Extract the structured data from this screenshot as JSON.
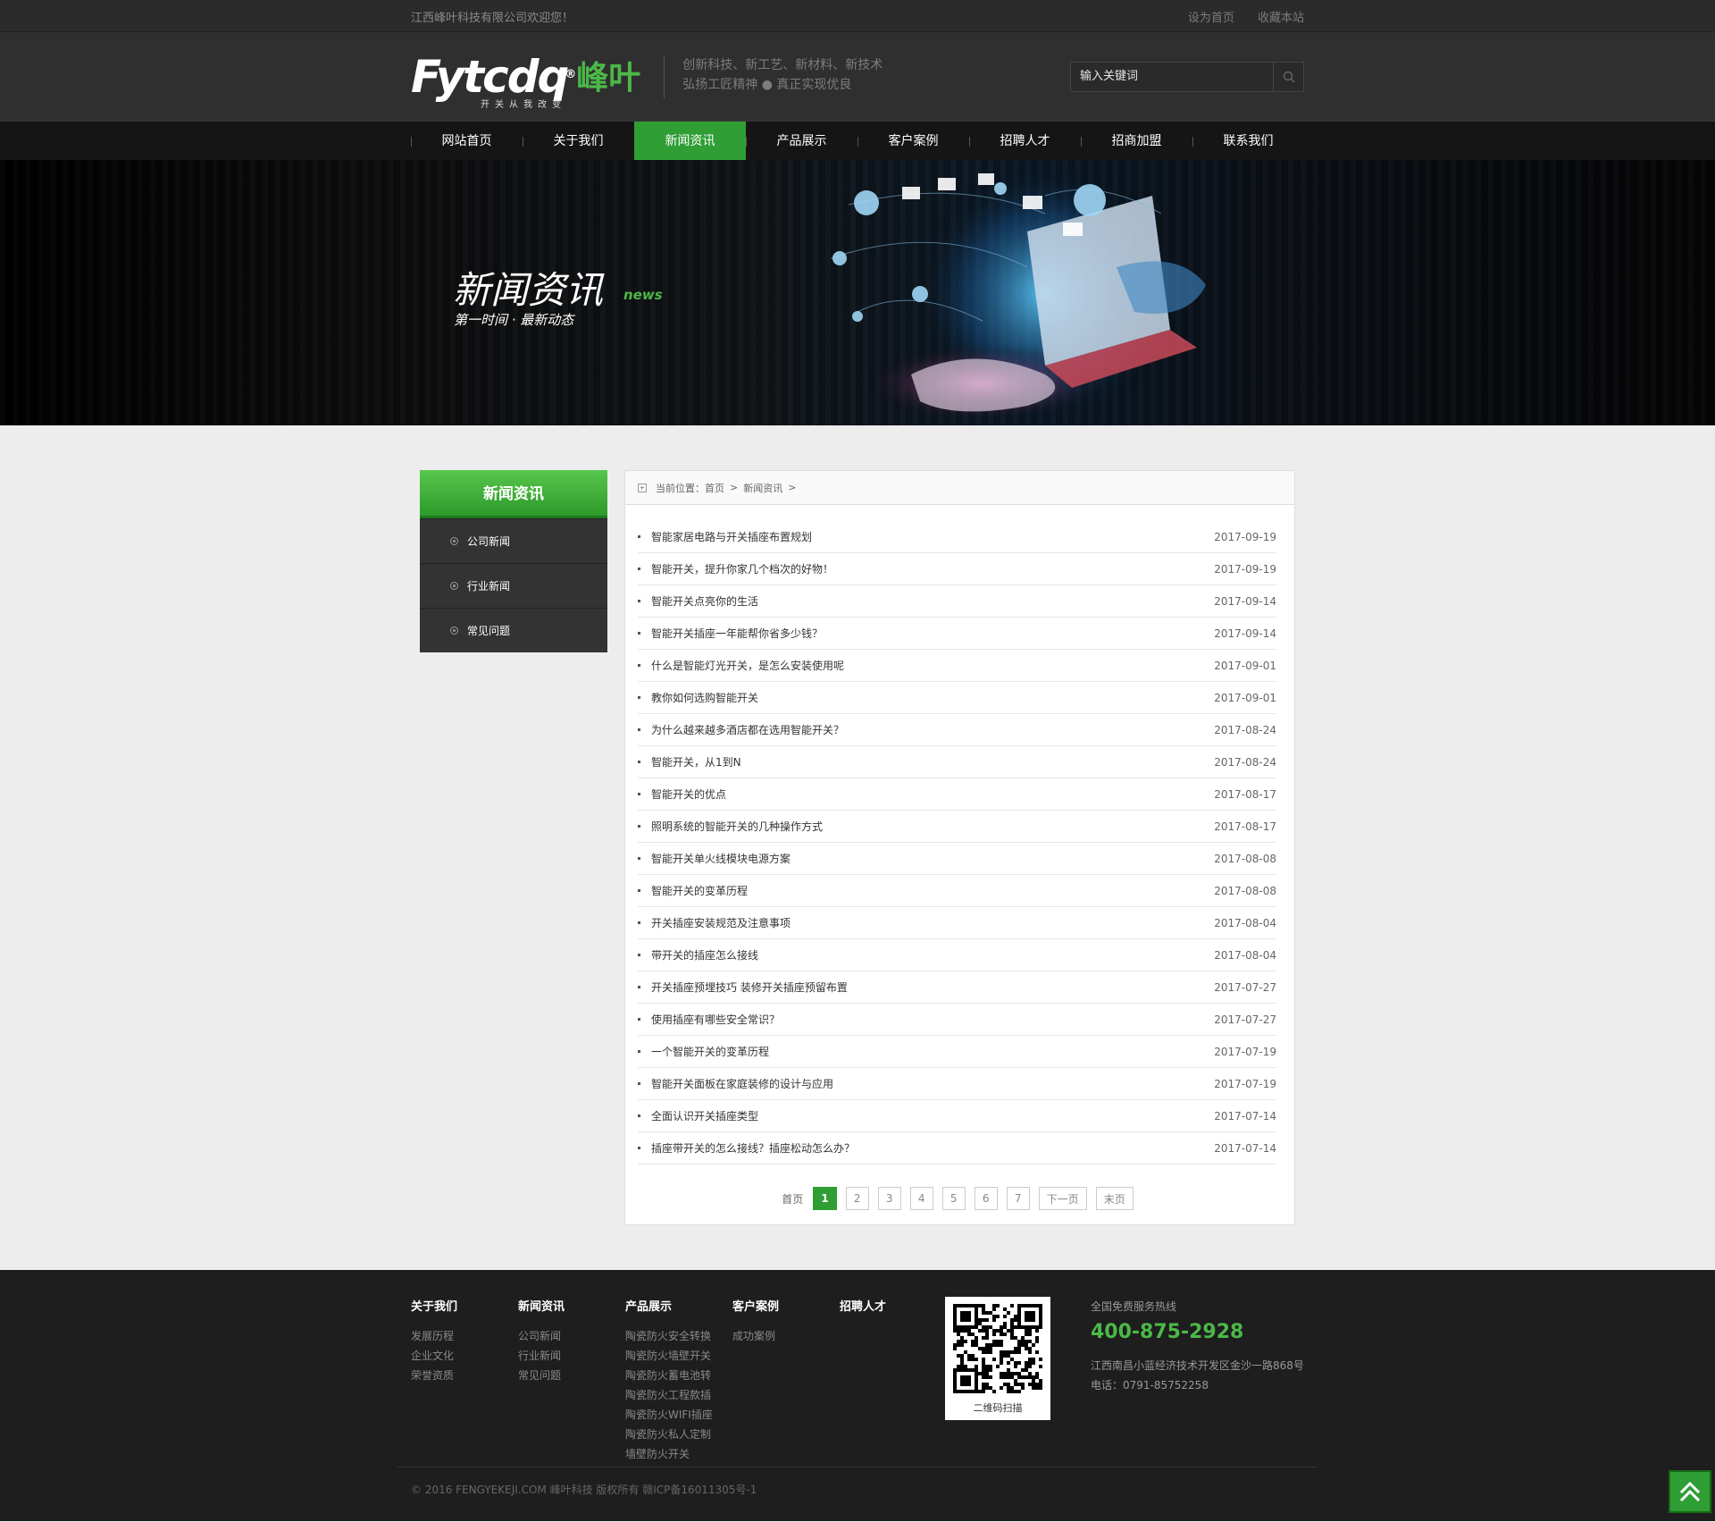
{
  "topbar": {
    "welcome": "江西峰叶科技有限公司欢迎您！",
    "links": [
      "设为首页",
      "收藏本站"
    ]
  },
  "header": {
    "logo_text": "Fytcdq",
    "logo_reg": "®",
    "logo_cn": "峰叶",
    "logo_sub": "开关从我改变",
    "slogan": [
      "创新科技、新工艺、新材料、新技术",
      "弘扬工匠精神 ● 真正实现优良"
    ],
    "search_placeholder": "输入关键词"
  },
  "nav": {
    "items": [
      "网站首页",
      "关于我们",
      "新闻资讯",
      "产品展示",
      "客户案例",
      "招聘人才",
      "招商加盟",
      "联系我们"
    ],
    "active_index": 2
  },
  "banner": {
    "title": "新闻资讯",
    "en": "news",
    "sub": "第一时间 · 最新动态"
  },
  "sidebar": {
    "title": "新闻资讯",
    "items": [
      "公司新闻",
      "行业新闻",
      "常见问题"
    ]
  },
  "breadcrumb": {
    "label": "当前位置：首页",
    "current": "新闻资讯",
    "sep": ">"
  },
  "news": [
    {
      "title": "智能家居电路与开关插座布置规划",
      "date": "2017-09-19"
    },
    {
      "title": "智能开关，提升你家几个档次的好物！",
      "date": "2017-09-19"
    },
    {
      "title": "智能开关点亮你的生活",
      "date": "2017-09-14"
    },
    {
      "title": "智能开关插座一年能帮你省多少钱？",
      "date": "2017-09-14"
    },
    {
      "title": "什么是智能灯光开关，是怎么安装使用呢",
      "date": "2017-09-01"
    },
    {
      "title": "教你如何选购智能开关",
      "date": "2017-09-01"
    },
    {
      "title": "为什么越来越多酒店都在选用智能开关？",
      "date": "2017-08-24"
    },
    {
      "title": "智能开关，从1到N",
      "date": "2017-08-24"
    },
    {
      "title": "智能开关的优点",
      "date": "2017-08-17"
    },
    {
      "title": "照明系统的智能开关的几种操作方式",
      "date": "2017-08-17"
    },
    {
      "title": "智能开关单火线模块电源方案",
      "date": "2017-08-08"
    },
    {
      "title": "智能开关的变革历程",
      "date": "2017-08-08"
    },
    {
      "title": "开关插座安装规范及注意事项",
      "date": "2017-08-04"
    },
    {
      "title": "带开关的插座怎么接线",
      "date": "2017-08-04"
    },
    {
      "title": "开关插座预埋技巧 装修开关插座预留布置",
      "date": "2017-07-27"
    },
    {
      "title": "使用插座有哪些安全常识？",
      "date": "2017-07-27"
    },
    {
      "title": "一个智能开关的变革历程",
      "date": "2017-07-19"
    },
    {
      "title": "智能开关面板在家庭装修的设计与应用",
      "date": "2017-07-19"
    },
    {
      "title": "全面认识开关插座类型",
      "date": "2017-07-14"
    },
    {
      "title": "插座带开关的怎么接线？插座松动怎么办？",
      "date": "2017-07-14"
    }
  ],
  "pager": {
    "first": "首页",
    "pages": [
      "1",
      "2",
      "3",
      "4",
      "5",
      "6",
      "7"
    ],
    "current": "1",
    "next": "下一页",
    "last": "末页"
  },
  "footer": {
    "columns": [
      {
        "title": "关于我们",
        "items": [
          "发展历程",
          "企业文化",
          "荣誉资质"
        ]
      },
      {
        "title": "新闻资讯",
        "items": [
          "公司新闻",
          "行业新闻",
          "常见问题"
        ]
      },
      {
        "title": "产品展示",
        "items": [
          "陶瓷防火安全转换",
          "陶瓷防火墙壁开关",
          "陶瓷防火蓄电池转",
          "陶瓷防火工程款插",
          "陶瓷防火WIFI插座",
          "陶瓷防火私人定制",
          "墙壁防火开关"
        ]
      },
      {
        "title": "客户案例",
        "items": [
          "成功案例"
        ]
      },
      {
        "title": "招聘人才",
        "items": []
      }
    ],
    "qr_caption": "二维码扫描",
    "hotline_label": "全国免费服务热线",
    "hotline": "400-875-2928",
    "address": "江西南昌小蓝经济技术开发区金沙一路868号",
    "tel": "电话：0791-85752258",
    "copyright": "© 2016 FENGYEKEJI.COM 峰叶科技 版权所有 赣ICP备16011305号-1"
  },
  "colors": {
    "accent": "#2f9e35",
    "brand_green": "#4cb848",
    "dark": "#151515"
  }
}
